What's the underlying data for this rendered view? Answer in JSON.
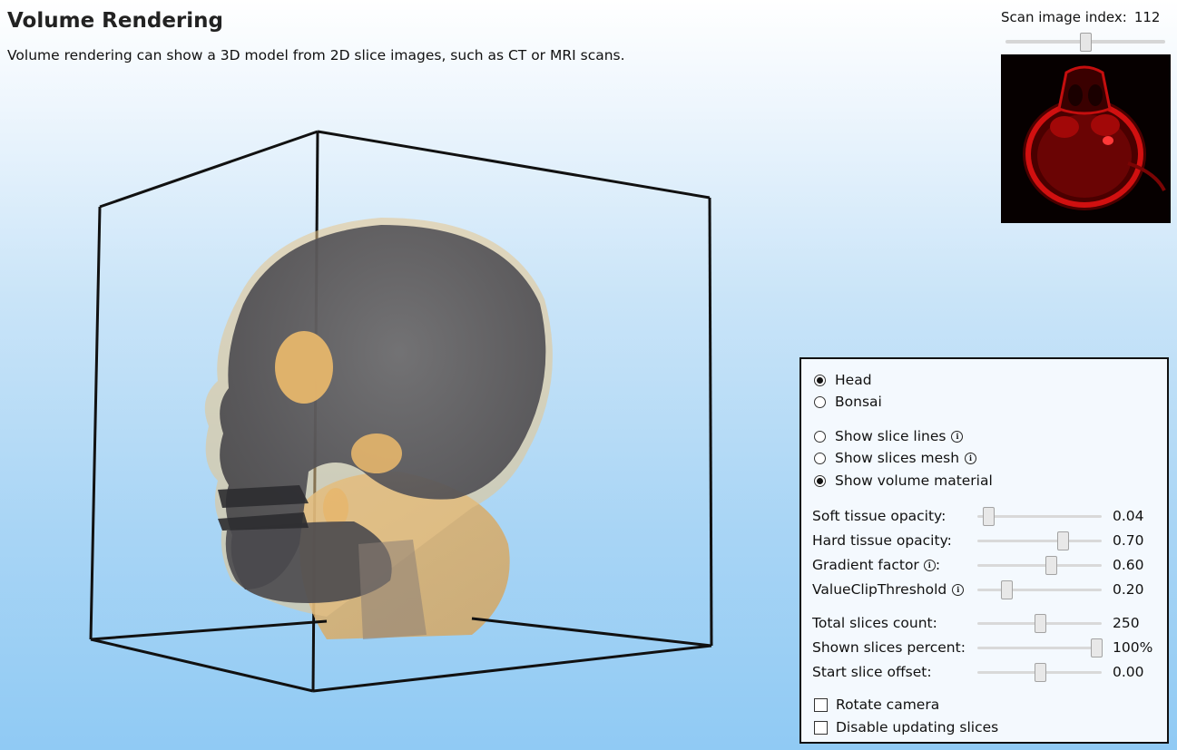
{
  "header": {
    "title": "Volume Rendering",
    "subtitle": "Volume rendering can show a 3D model from 2D slice images, such as CT or MRI scans."
  },
  "scan": {
    "label": "Scan image index:",
    "value": "112",
    "index_fraction": 0.5
  },
  "dataset": {
    "options": [
      {
        "label": "Head",
        "checked": true
      },
      {
        "label": "Bonsai",
        "checked": false
      }
    ]
  },
  "display_mode": {
    "options": [
      {
        "label": "Show slice lines",
        "checked": false,
        "info": true
      },
      {
        "label": "Show slices mesh",
        "checked": false,
        "info": true
      },
      {
        "label": "Show volume material",
        "checked": true,
        "info": false
      }
    ]
  },
  "sliders": [
    {
      "label": "Soft tissue opacity:",
      "value": "0.04",
      "fraction": 0.04,
      "info": false
    },
    {
      "label": "Hard tissue opacity:",
      "value": "0.70",
      "fraction": 0.7,
      "info": false
    },
    {
      "label": "Gradient factor",
      "suffix": ":",
      "value": "0.60",
      "fraction": 0.6,
      "info": true
    },
    {
      "label": "ValueClipThreshold",
      "suffix": "",
      "value": "0.20",
      "fraction": 0.2,
      "info": true
    },
    {
      "label": "Total slices count:",
      "value": "250",
      "fraction": 0.5,
      "info": false
    },
    {
      "label": "Shown slices percent:",
      "value": "100%",
      "fraction": 1.0,
      "info": false
    },
    {
      "label": "Start slice offset:",
      "value": "0.00",
      "fraction": 0.5,
      "info": false
    }
  ],
  "checkboxes": [
    {
      "label": "Rotate camera",
      "checked": false
    },
    {
      "label": "Disable updating slices",
      "checked": false
    }
  ],
  "icons": {
    "info": "info-icon",
    "info_glyph": "i"
  }
}
